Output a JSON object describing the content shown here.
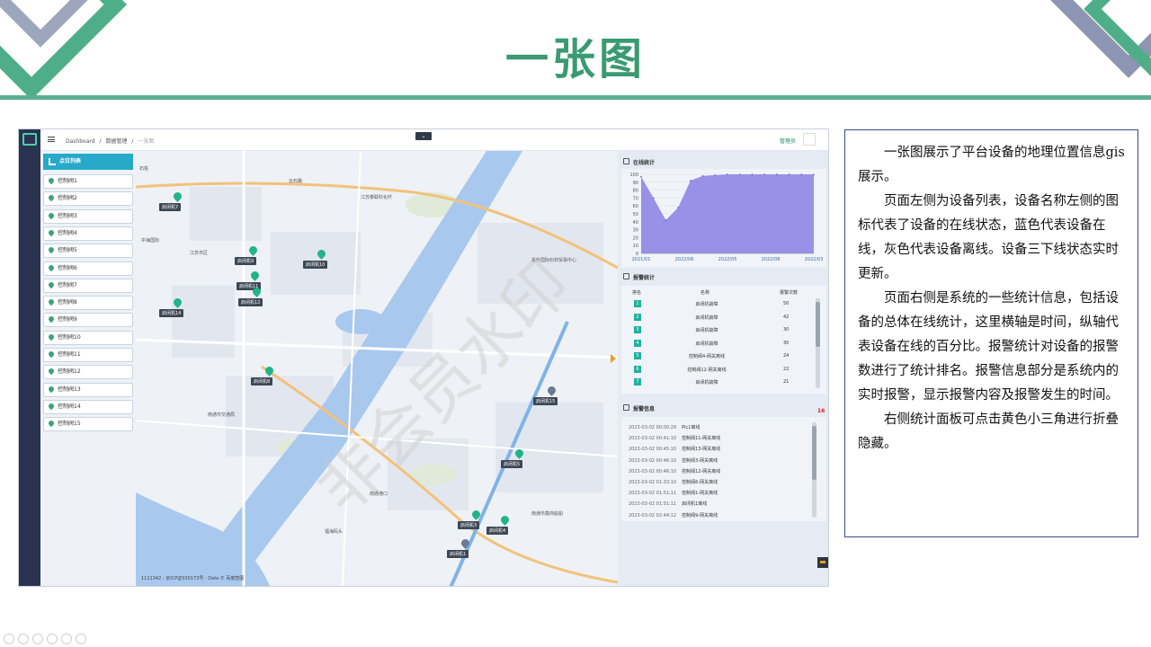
{
  "slide": {
    "title": "一张图"
  },
  "app": {
    "breadcrumb": [
      "Dashboard",
      "/",
      "数据管理",
      "/",
      "一张图"
    ],
    "admin_label": "管理员",
    "sidebar": {
      "header": "点位列表",
      "items": [
        "控制阀1",
        "控制阀2",
        "控制阀3",
        "控制阀4",
        "控制阀5",
        "控制阀6",
        "控制阀7",
        "控制阀8",
        "控制阀9",
        "控制阀10",
        "控制阀11",
        "控制阀12",
        "控制阀13",
        "控制阀14",
        "控制阀15"
      ]
    },
    "map": {
      "labels": [
        "石桩",
        "云石路",
        "江苏泰联科化纤",
        "东升国际石材贸易中心",
        "南通市交通局",
        "南通港口",
        "江苏市区",
        "中海国际",
        "南通市鑫商船船",
        "福海码头"
      ],
      "markers": [
        {
          "label": "启闭机7",
          "status": "online"
        },
        {
          "label": "启闭机9",
          "status": "online"
        },
        {
          "label": "启闭机10",
          "status": "online"
        },
        {
          "label": "启闭机11",
          "status": "online"
        },
        {
          "label": "启闭机12",
          "status": "online"
        },
        {
          "label": "启闭机14",
          "status": "online"
        },
        {
          "label": "启闭机8",
          "status": "online"
        },
        {
          "label": "启闭机15",
          "status": "offline"
        },
        {
          "label": "启闭机5",
          "status": "online"
        },
        {
          "label": "启闭机3",
          "status": "online"
        },
        {
          "label": "启闭机4",
          "status": "online"
        },
        {
          "label": "启闭机1",
          "status": "offline"
        }
      ],
      "copyright": "1111342 - 京ICP证030173号 - Data © 百度智图"
    },
    "online_stats": {
      "title": "在线统计"
    },
    "alarm_stats": {
      "title": "报警统计",
      "headers": [
        "排名",
        "名称",
        "报警次数"
      ],
      "rows": [
        {
          "rank": "1",
          "name": "启闭机故障",
          "count": "50"
        },
        {
          "rank": "2",
          "name": "启闭机故障",
          "count": "42"
        },
        {
          "rank": "3",
          "name": "启闭机故障",
          "count": "30"
        },
        {
          "rank": "4",
          "name": "启闭机故障",
          "count": "30"
        },
        {
          "rank": "5",
          "name": "控制阀4-网关离线",
          "count": "24"
        },
        {
          "rank": "6",
          "name": "控制阀12-网关离线",
          "count": "22"
        },
        {
          "rank": "7",
          "name": "启闭机故障",
          "count": "21"
        }
      ]
    },
    "alarm_info": {
      "title": "报警信息",
      "count": "16",
      "rows": [
        {
          "time": "2023-03-02 00:00:29",
          "msg": "Plc1离线"
        },
        {
          "time": "2023-03-02 00:41:10",
          "msg": "控制阀11-网关离线"
        },
        {
          "time": "2023-03-02 00:45:10",
          "msg": "控制阀13-网关离线"
        },
        {
          "time": "2023-03-02 00:46:10",
          "msg": "控制阀3-网关离线"
        },
        {
          "time": "2023-03-02 00:46:10",
          "msg": "控制阀12-网关离线"
        },
        {
          "time": "2023-03-02 01:33:10",
          "msg": "控制阀6-网关离线"
        },
        {
          "time": "2023-03-02 01:51:11",
          "msg": "控制阀1-网关离线"
        },
        {
          "time": "2023-03-02 01:51:11",
          "msg": "启闭机1离线"
        },
        {
          "time": "2023-03-02 02:44:12",
          "msg": "控制阀9-网关离线"
        }
      ]
    }
  },
  "chart_data": {
    "type": "area",
    "x": [
      "2021/01",
      "2021/02",
      "2021/03",
      "2021/04",
      "2021/05",
      "2021/06",
      "2021/07",
      "2021/08",
      "2021/09",
      "2021/10",
      "2021/11",
      "2021/12",
      "2022/01",
      "2022/02",
      "2022/03"
    ],
    "x_tick_labels": [
      "2021/01",
      "2022/06",
      "2022/05",
      "2022/08",
      "2022/03"
    ],
    "values": [
      97,
      70,
      42,
      58,
      92,
      98,
      99,
      100,
      100,
      100,
      100,
      100,
      100,
      100,
      100
    ],
    "ylim": [
      0,
      100
    ],
    "y_ticks": [
      0,
      10,
      20,
      30,
      40,
      50,
      60,
      70,
      80,
      90,
      100
    ],
    "color": "#8f86e6"
  },
  "description": {
    "paragraphs": [
      "一张图展示了平台设备的地理位置信息gis展示。",
      "页面左侧为设备列表，设备名称左侧的图标代表了设备的在线状态，蓝色代表设备在线，灰色代表设备离线。设备三下线状态实时更新。",
      "页面右侧是系统的一些统计信息，包括设备的总体在线统计，这里横轴是时间，纵轴代表设备在线的百分比。报警统计对设备的报警数进行了统计排名。报警信息部分是系统内的实时报警，显示报警内容及报警发生的时间。",
      "右侧统计面板可点击黄色小三角进行折叠隐藏。"
    ]
  }
}
